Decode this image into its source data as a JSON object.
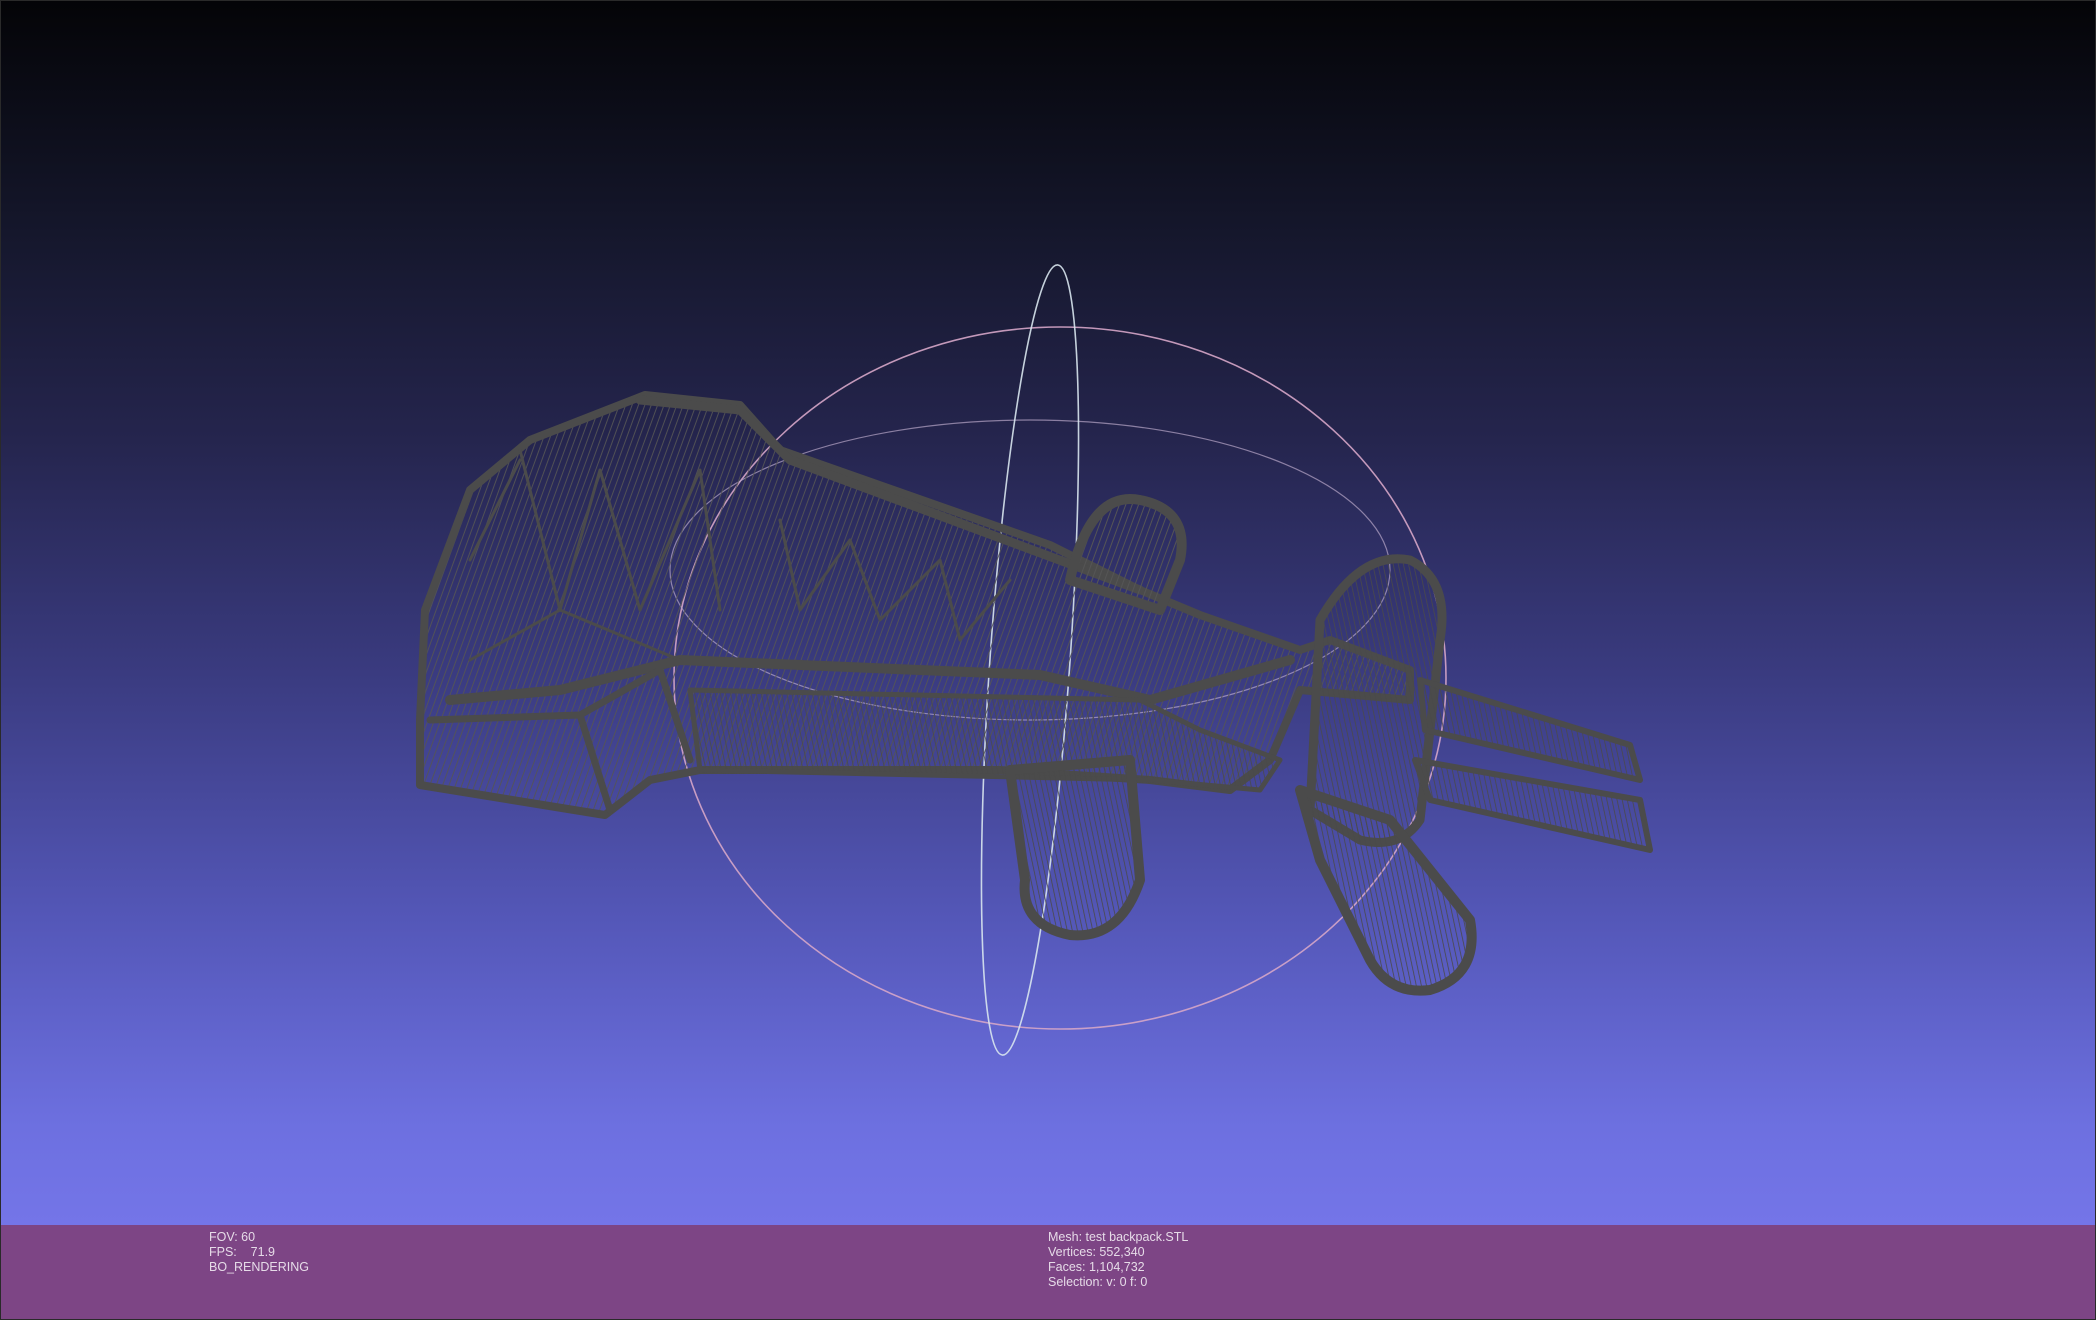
{
  "viewport": {
    "background_top": "#040407",
    "background_bottom": "#7475e8",
    "mesh_color": "#4b4b4b",
    "trackball_colors": {
      "horizontal": "#d6a6c8",
      "vertical": "#d8e6ee",
      "inner": "#b8a6c8"
    },
    "render_mode": "wireframe"
  },
  "info_bar": {
    "background": "#7d4585",
    "fov": "FOV: 60",
    "fps": "FPS:    71.9",
    "rendering": "BO_RENDERING",
    "mesh": "Mesh: test backpack.STL",
    "vertices": "Vertices: 552,340",
    "faces": "Faces: 1,104,732",
    "selection": "Selection: v: 0 f: 0"
  }
}
